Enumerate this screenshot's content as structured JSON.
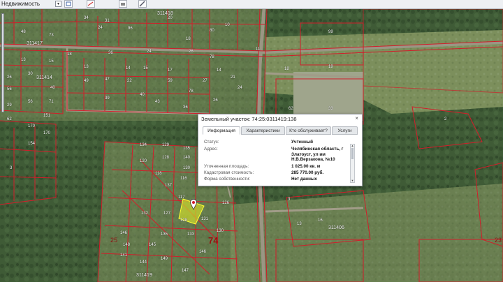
{
  "toolbar": {
    "layer_select": "Недвижимость",
    "buttons": [
      "layers-icon",
      "measure-icon",
      "print-icon",
      "draw-icon"
    ]
  },
  "map": {
    "colors": {
      "forest": "#3d5a34",
      "field": "#7f9360",
      "parcel_line": "#d21d2a",
      "road": "#9a9684",
      "highlight": "#d6e22a"
    },
    "parcel_numbers": [
      "34",
      "31",
      "96",
      "20",
      "18",
      "80",
      "24",
      "48",
      "73",
      "13",
      "14",
      "15",
      "17",
      "36",
      "43",
      "40",
      "39",
      "26",
      "24",
      "14",
      "21",
      "56",
      "26",
      "40",
      "30",
      "56",
      "59",
      "22",
      "27",
      "78",
      "47",
      "49",
      "13",
      "15",
      "29",
      "170",
      "151",
      "170",
      "154",
      "3",
      "134",
      "129",
      "135",
      "140",
      "128",
      "130",
      "120",
      "118",
      "117",
      "116",
      "127",
      "128",
      "132",
      "131",
      "133",
      "126",
      "130",
      "135",
      "137",
      "145",
      "148",
      "146",
      "141",
      "144",
      "149",
      "147",
      "146",
      "99",
      "33",
      "62",
      "2",
      "19",
      "3",
      "16",
      "13",
      "18",
      "11",
      "18",
      "24",
      "26",
      "36",
      "10",
      "78",
      "62",
      "71"
    ],
    "district_labels": [
      "311417",
      "311414",
      "311418",
      "311419",
      "311406"
    ],
    "numbers_large": [
      "74"
    ],
    "numbers_medium": [
      "25",
      "23"
    ]
  },
  "popup": {
    "title": "Земельный участок: 74:25:0311419:138",
    "close": "×",
    "tabs": [
      "Информация",
      "Характеристики",
      "Кто обслуживает?",
      "Услуги"
    ],
    "rows": [
      {
        "label": "Статус:",
        "value": "Учтенный"
      },
      {
        "label": "Адрес:",
        "value": "Челябинская область, г Златоуст, ул им Н.В.Верзакова, №10"
      },
      {
        "label": "Уточненная площадь:",
        "value": "1 025.00 кв. м"
      },
      {
        "label": "Кадастровая стоимость:",
        "value": "285 770.00 руб."
      },
      {
        "label": "Форма собственности:",
        "value": "Нет данных"
      }
    ]
  }
}
